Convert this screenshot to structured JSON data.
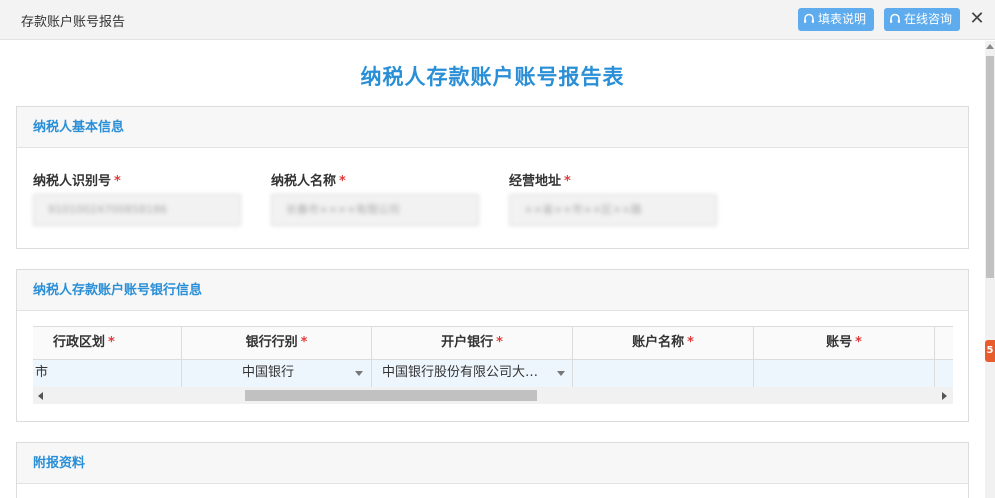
{
  "window": {
    "title": "存款账户账号报告",
    "help_label": "填表说明",
    "consult_label": "在线咨询",
    "close_glyph": "✕"
  },
  "colors": {
    "accent": "#2a8fd6",
    "button": "#5eacee",
    "required": "#e23b3b"
  },
  "page": {
    "title": "纳税人存款账户账号报告表"
  },
  "basic_info": {
    "heading": "纳税人基本信息",
    "fields": [
      {
        "label": "纳税人识别号",
        "required_mark": "*",
        "value": "91010024700858186"
      },
      {
        "label": "纳税人名称",
        "required_mark": "*",
        "value": "长春市××××有限公司"
      },
      {
        "label": "经营地址",
        "required_mark": "*",
        "value": "××省××市××区××路"
      }
    ]
  },
  "bank_info": {
    "heading": "纳税人存款账户账号银行信息",
    "columns": [
      {
        "label": "行政区划",
        "required_mark": "*"
      },
      {
        "label": "银行行别",
        "required_mark": "*"
      },
      {
        "label": "开户银行",
        "required_mark": "*"
      },
      {
        "label": "账户名称",
        "required_mark": "*"
      },
      {
        "label": "账号",
        "required_mark": "*"
      }
    ],
    "rows": [
      {
        "region": "市",
        "bank_type": "中国银行",
        "bank": "中国银行股份有限公司大…",
        "account_name": "",
        "account_no": ""
      }
    ]
  },
  "attachments": {
    "heading": "附报资料"
  },
  "scroll_mark": "5"
}
